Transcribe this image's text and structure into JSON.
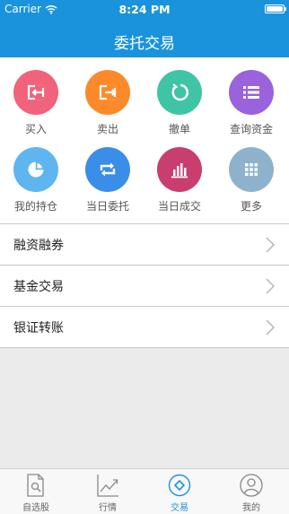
{
  "status_bar": {
    "carrier": "Carrier",
    "time": "8:24 PM"
  },
  "header": {
    "title": "委托交易"
  },
  "actions": [
    {
      "label": "买入",
      "icon": "buy-in-icon",
      "color": "#f0637a"
    },
    {
      "label": "卖出",
      "icon": "sell-out-icon",
      "color": "#fd8a2a"
    },
    {
      "label": "撤单",
      "icon": "cancel-order-icon",
      "color": "#3fc4a6"
    },
    {
      "label": "查询资金",
      "icon": "fund-list-icon",
      "color": "#9a62dc"
    },
    {
      "label": "我的持仓",
      "icon": "pie-chart-icon",
      "color": "#5fb6ee"
    },
    {
      "label": "当日委托",
      "icon": "repeat-icon",
      "color": "#3a8ee8"
    },
    {
      "label": "当日成交",
      "icon": "bar-chart-icon",
      "color": "#c83e6e"
    },
    {
      "label": "更多",
      "icon": "grid-more-icon",
      "color": "#8fb2cc"
    }
  ],
  "menu": [
    {
      "label": "融资融券"
    },
    {
      "label": "基金交易"
    },
    {
      "label": "银证转账"
    }
  ],
  "tabbar": {
    "active_color": "#1a93dc",
    "items": [
      {
        "label": "自选股",
        "icon": "watchlist-icon"
      },
      {
        "label": "行情",
        "icon": "market-trend-icon"
      },
      {
        "label": "交易",
        "icon": "trade-icon",
        "active": true
      },
      {
        "label": "我的",
        "icon": "profile-icon"
      }
    ]
  }
}
